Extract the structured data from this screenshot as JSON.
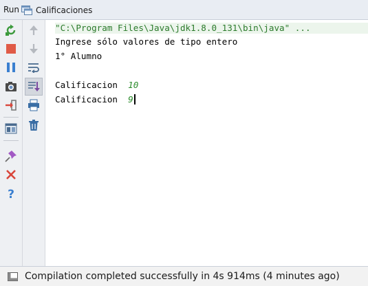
{
  "tabbar": {
    "run_label": "Run",
    "tab_label": "Calificaciones"
  },
  "toolbar_left": [
    {
      "name": "rerun-icon",
      "color": "#3c9a3c"
    },
    {
      "name": "stop-icon",
      "color": "#e05b47"
    },
    {
      "name": "pause-icon",
      "color": "#3a7fd0"
    },
    {
      "name": "dump-threads-icon",
      "color": "#555555"
    },
    {
      "name": "exit-icon",
      "color": "#d9463b"
    },
    {
      "name": "layout-icon",
      "color": "#4a6b8f"
    },
    {
      "name": "pin-icon",
      "color": "#9b59b6"
    },
    {
      "name": "close-icon",
      "color": "#d9463b"
    },
    {
      "name": "help-icon",
      "color": "#3a7fd0"
    }
  ],
  "toolbar_right": [
    {
      "name": "up-arrow-icon"
    },
    {
      "name": "down-arrow-icon"
    },
    {
      "name": "soft-wrap-icon"
    },
    {
      "name": "scroll-to-end-icon"
    },
    {
      "name": "print-icon"
    },
    {
      "name": "clear-all-icon"
    }
  ],
  "console": {
    "command": "\"C:\\Program Files\\Java\\jdk1.8.0_131\\bin\\java\" ...",
    "line1": "Ingrese sólo valores de tipo entero",
    "line2": "1° Alumno",
    "line3_label": "Calificacion  ",
    "line3_input": "10",
    "line4_label": "Calificacion  ",
    "line4_input": "9"
  },
  "status": {
    "text": "Compilation completed successfully in 4s 914ms (4 minutes ago)"
  }
}
